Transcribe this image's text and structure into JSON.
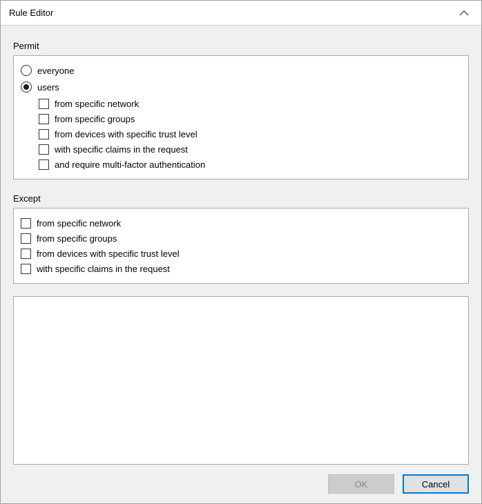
{
  "title": "Rule Editor",
  "permit": {
    "label": "Permit",
    "radios": {
      "everyone": "everyone",
      "users": "users"
    },
    "checks": {
      "network": "from specific network",
      "groups": "from specific groups",
      "trust": "from devices with specific trust level",
      "claims": "with specific claims in the request",
      "mfa": "and require multi-factor authentication"
    }
  },
  "except": {
    "label": "Except",
    "checks": {
      "network": "from specific network",
      "groups": "from specific groups",
      "trust": "from devices with specific trust level",
      "claims": "with specific claims in the request"
    }
  },
  "buttons": {
    "ok": "OK",
    "cancel": "Cancel"
  }
}
